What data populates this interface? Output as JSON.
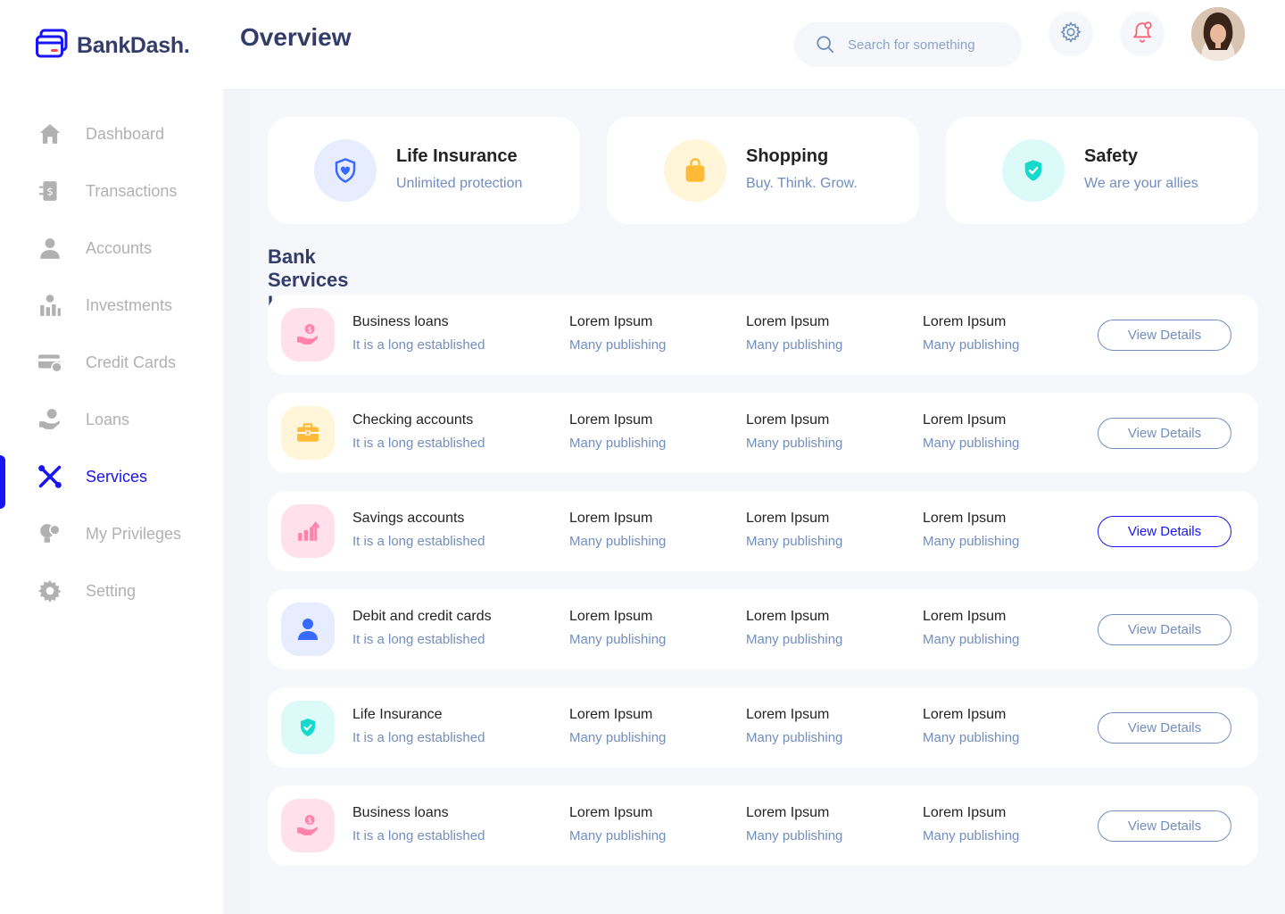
{
  "brand": {
    "name": "BankDash."
  },
  "header": {
    "title": "Overview",
    "search_placeholder": "Search for something"
  },
  "sidebar": {
    "items": [
      {
        "label": "Dashboard",
        "icon": "home-icon"
      },
      {
        "label": "Transactions",
        "icon": "transfer-icon"
      },
      {
        "label": "Accounts",
        "icon": "user-icon"
      },
      {
        "label": "Investments",
        "icon": "investment-icon"
      },
      {
        "label": "Credit Cards",
        "icon": "credit-card-icon"
      },
      {
        "label": "Loans",
        "icon": "loan-icon"
      },
      {
        "label": "Services",
        "icon": "services-icon",
        "active": true
      },
      {
        "label": "My Privileges",
        "icon": "privileges-icon"
      },
      {
        "label": "Setting",
        "icon": "gear-icon"
      }
    ]
  },
  "cards": [
    {
      "title": "Life Insurance",
      "subtitle": "Unlimited protection",
      "icon": "heart-shield-icon",
      "color": "#396aff",
      "bg": "#e7edff"
    },
    {
      "title": "Shopping",
      "subtitle": "Buy. Think. Grow.",
      "icon": "shopping-bag-icon",
      "color": "#ffbb38",
      "bg": "#fff5d9"
    },
    {
      "title": "Safety",
      "subtitle": "We are your allies",
      "icon": "shield-check-icon",
      "color": "#16dbcc",
      "bg": "#dcfaf8"
    }
  ],
  "services": {
    "title": "Bank Services List",
    "rows": [
      {
        "name": "Business loans",
        "desc": "It is a long established",
        "icon": "hand-coin-icon",
        "color": "#ff82ac",
        "bg": "#ffe0eb",
        "cols": [
          {
            "title": "Lorem Ipsum",
            "sub": "Many publishing"
          },
          {
            "title": "Lorem Ipsum",
            "sub": "Many publishing"
          },
          {
            "title": "Lorem Ipsum",
            "sub": "Many publishing"
          }
        ],
        "button": "View Details"
      },
      {
        "name": "Checking accounts",
        "desc": "It is a long established",
        "icon": "briefcase-icon",
        "color": "#ffbb38",
        "bg": "#fff5d9",
        "cols": [
          {
            "title": "Lorem Ipsum",
            "sub": "Many publishing"
          },
          {
            "title": "Lorem Ipsum",
            "sub": "Many publishing"
          },
          {
            "title": "Lorem Ipsum",
            "sub": "Many publishing"
          }
        ],
        "button": "View Details"
      },
      {
        "name": "Savings accounts",
        "desc": "It is a long established",
        "icon": "growth-chart-icon",
        "color": "#ff82ac",
        "bg": "#ffe0eb",
        "cols": [
          {
            "title": "Lorem Ipsum",
            "sub": "Many publishing"
          },
          {
            "title": "Lorem Ipsum",
            "sub": "Many publishing"
          },
          {
            "title": "Lorem Ipsum",
            "sub": "Many publishing"
          }
        ],
        "button": "View Details",
        "active": true
      },
      {
        "name": "Debit and credit cards",
        "desc": "It is a long established",
        "icon": "user-icon",
        "color": "#396aff",
        "bg": "#e7edff",
        "cols": [
          {
            "title": "Lorem Ipsum",
            "sub": "Many publishing"
          },
          {
            "title": "Lorem Ipsum",
            "sub": "Many publishing"
          },
          {
            "title": "Lorem Ipsum",
            "sub": "Many publishing"
          }
        ],
        "button": "View Details"
      },
      {
        "name": "Life Insurance",
        "desc": "It is a long established",
        "icon": "shield-check-icon",
        "color": "#16dbcc",
        "bg": "#dcfaf8",
        "cols": [
          {
            "title": "Lorem Ipsum",
            "sub": "Many publishing"
          },
          {
            "title": "Lorem Ipsum",
            "sub": "Many publishing"
          },
          {
            "title": "Lorem Ipsum",
            "sub": "Many publishing"
          }
        ],
        "button": "View Details"
      },
      {
        "name": "Business loans",
        "desc": "It is a long established",
        "icon": "hand-coin-icon",
        "color": "#ff82ac",
        "bg": "#ffe0eb",
        "cols": [
          {
            "title": "Lorem Ipsum",
            "sub": "Many publishing"
          },
          {
            "title": "Lorem Ipsum",
            "sub": "Many publishing"
          },
          {
            "title": "Lorem Ipsum",
            "sub": "Many publishing"
          }
        ],
        "button": "View Details"
      }
    ]
  },
  "colors": {
    "accent": "#1814f3",
    "heading": "#343c6a",
    "muted": "#718ebf",
    "inactive": "#b1b1b1"
  }
}
